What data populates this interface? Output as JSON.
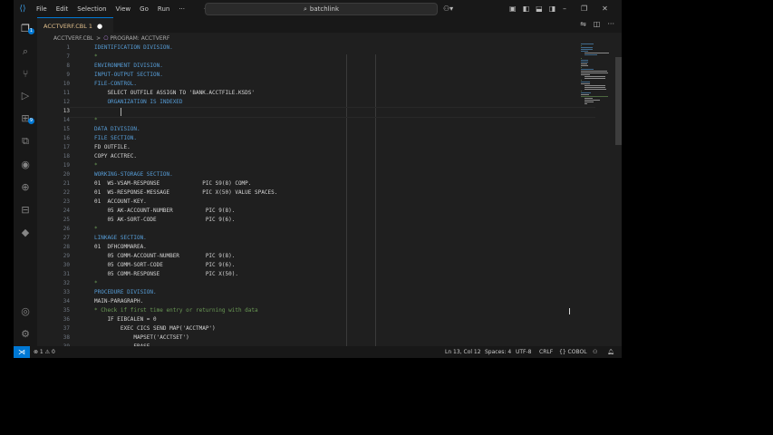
{
  "menu": [
    "File",
    "Edit",
    "Selection",
    "View",
    "Go",
    "Run",
    "···"
  ],
  "nav": {
    "back": "←",
    "forward": "→"
  },
  "search": {
    "label": "batchlink"
  },
  "tab": {
    "label": "ACCTVERF.CBL 1",
    "dirty": "●"
  },
  "breadcrumb": {
    "file": "ACCTVERF.CBL",
    "sep": ">",
    "symbol": "PROGRAM: ACCTVERF"
  },
  "editor": {
    "lines": [
      {
        "n": "1",
        "text": "IDENTIFICATION DIVISION.",
        "color": "#569cd6"
      },
      {
        "n": "7",
        "text": "*",
        "color": "#6a9955"
      },
      {
        "n": "8",
        "text": "ENVIRONMENT DIVISION.",
        "color": "#569cd6"
      },
      {
        "n": "9",
        "text": "INPUT-OUTPUT SECTION.",
        "color": "#569cd6"
      },
      {
        "n": "10",
        "text": "FILE-CONTROL.",
        "color": "#569cd6"
      },
      {
        "n": "11",
        "text": "    SELECT OUTFILE ASSIGN TO 'BANK.ACCTFILE.KSDS'",
        "color": "#d4d4d4"
      },
      {
        "n": "12",
        "text": "    ORGANIZATION IS INDEXED",
        "color": "#569cd6"
      },
      {
        "n": "13",
        "text": "",
        "color": "#d4d4d4"
      },
      {
        "n": "14",
        "text": "*",
        "color": "#6a9955"
      },
      {
        "n": "15",
        "text": "DATA DIVISION.",
        "color": "#569cd6"
      },
      {
        "n": "16",
        "text": "FILE SECTION.",
        "color": "#569cd6"
      },
      {
        "n": "17",
        "text": "FD OUTFILE.",
        "color": "#d4d4d4"
      },
      {
        "n": "18",
        "text": "COPY ACCTREC.",
        "color": "#d4d4d4"
      },
      {
        "n": "19",
        "text": "*",
        "color": "#6a9955"
      },
      {
        "n": "20",
        "text": "WORKING-STORAGE SECTION.",
        "color": "#569cd6"
      },
      {
        "n": "21",
        "text": "01  WS-VSAM-RESPONSE             PIC S9(8) COMP.",
        "color": "#d4d4d4"
      },
      {
        "n": "22",
        "text": "01  WS-RESPONSE-MESSAGE          PIC X(50) VALUE SPACES.",
        "color": "#d4d4d4"
      },
      {
        "n": "23",
        "text": "01  ACCOUNT-KEY.",
        "color": "#d4d4d4"
      },
      {
        "n": "24",
        "text": "    05 AK-ACCOUNT-NUMBER          PIC 9(8).",
        "color": "#d4d4d4"
      },
      {
        "n": "25",
        "text": "    05 AK-SORT-CODE               PIC 9(6).",
        "color": "#d4d4d4"
      },
      {
        "n": "26",
        "text": "*",
        "color": "#6a9955"
      },
      {
        "n": "27",
        "text": "LINKAGE SECTION.",
        "color": "#569cd6"
      },
      {
        "n": "28",
        "text": "01  DFHCOMMAREA.",
        "color": "#d4d4d4"
      },
      {
        "n": "29",
        "text": "    05 COMM-ACCOUNT-NUMBER        PIC 9(8).",
        "color": "#d4d4d4"
      },
      {
        "n": "30",
        "text": "    05 COMM-SORT-CODE             PIC 9(6).",
        "color": "#d4d4d4"
      },
      {
        "n": "31",
        "text": "    05 COMM-RESPONSE              PIC X(50).",
        "color": "#d4d4d4"
      },
      {
        "n": "32",
        "text": "*",
        "color": "#6a9955"
      },
      {
        "n": "33",
        "text": "PROCEDURE DIVISION.",
        "color": "#569cd6"
      },
      {
        "n": "34",
        "text": "MAIN-PARAGRAPH.",
        "color": "#d4d4d4"
      },
      {
        "n": "35",
        "text": "* Check if first time entry or returning with data",
        "color": "#6a9955"
      },
      {
        "n": "36",
        "text": "    IF EIBCALEN = 0",
        "color": "#d4d4d4"
      },
      {
        "n": "37",
        "text": "        EXEC CICS SEND MAP('ACCTMAP')",
        "color": "#d4d4d4"
      },
      {
        "n": "38",
        "text": "            MAPSET('ACCTSET')",
        "color": "#d4d4d4"
      },
      {
        "n": "39",
        "text": "            ERASE",
        "color": "#d4d4d4"
      }
    ],
    "current_line": "13"
  },
  "status": {
    "remote": "⋊",
    "problems": "⊗ 1 ⚠ 0",
    "position": "Ln 13, Col 12",
    "spaces": "Spaces: 4",
    "encoding": "UTF-8",
    "eol": "CRLF",
    "language": "{} COBOL",
    "badges": {
      "explorer": "1",
      "extensions": "9"
    }
  }
}
